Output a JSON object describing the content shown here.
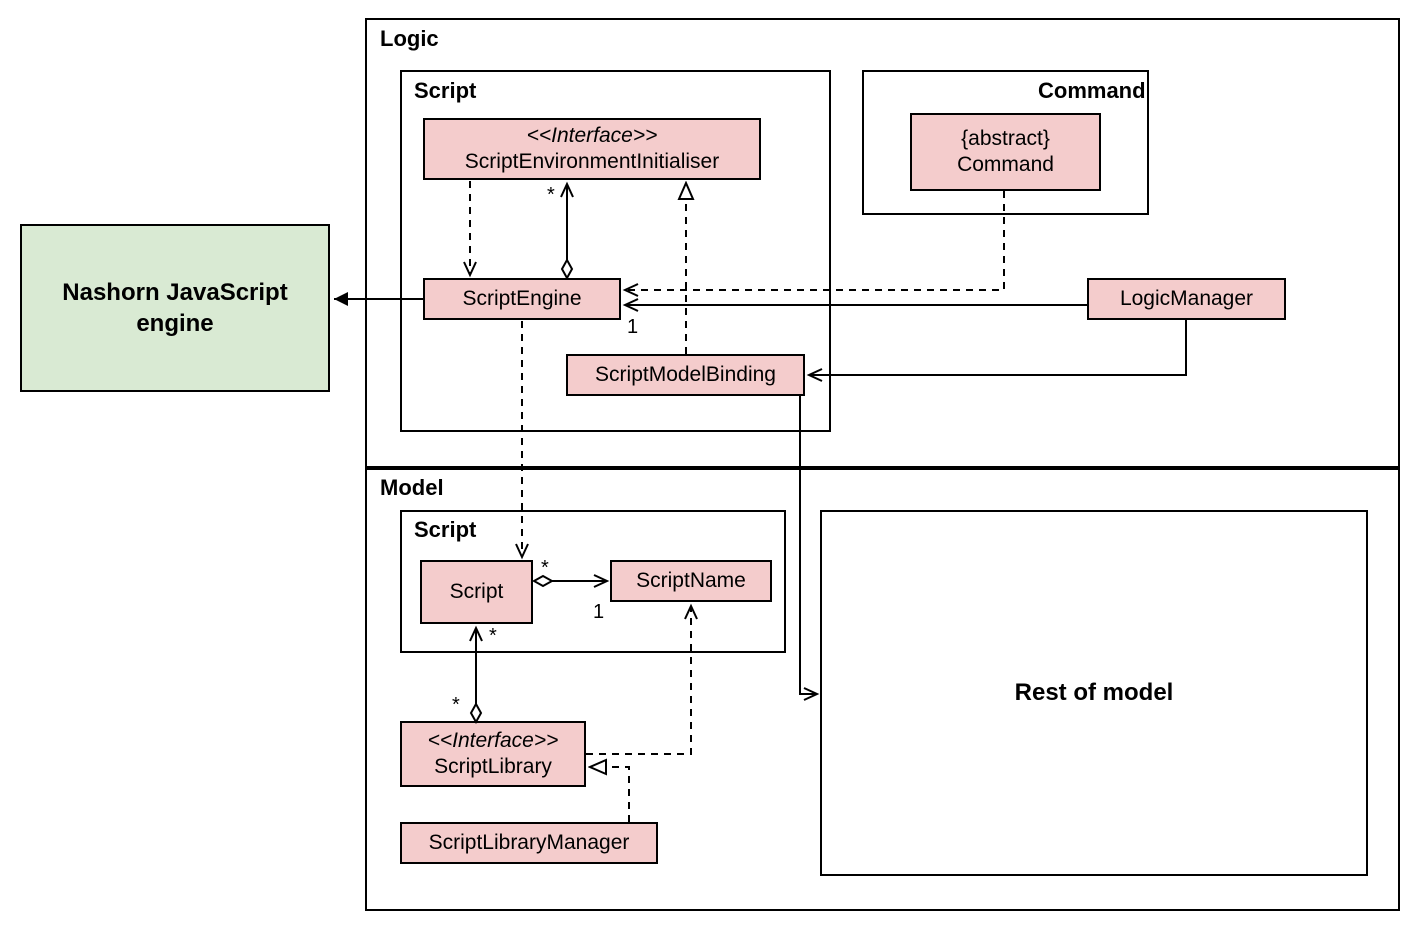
{
  "packages": {
    "logic": {
      "label": "Logic"
    },
    "logic_script": {
      "label": "Script"
    },
    "logic_command": {
      "label": "Command"
    },
    "model": {
      "label": "Model"
    },
    "model_script": {
      "label": "Script"
    }
  },
  "classes": {
    "nashorn": {
      "line1": "Nashorn JavaScript",
      "line2": "engine"
    },
    "script_env_init": {
      "stereotype": "<<Interface>>",
      "name": "ScriptEnvironmentInitialiser"
    },
    "script_engine": {
      "name": "ScriptEngine"
    },
    "script_model_binding": {
      "name": "ScriptModelBinding"
    },
    "command_abstract": {
      "stereotype": "{abstract}",
      "name": "Command"
    },
    "logic_manager": {
      "name": "LogicManager"
    },
    "script": {
      "name": "Script"
    },
    "script_name": {
      "name": "ScriptName"
    },
    "script_library": {
      "stereotype": "<<Interface>>",
      "name": "ScriptLibrary"
    },
    "script_library_manager": {
      "name": "ScriptLibraryManager"
    },
    "rest_of_model": {
      "name": "Rest of model"
    }
  },
  "multiplicities": {
    "m1": "*",
    "m2": "1",
    "m3": "*",
    "m4": "*",
    "m5": "1",
    "m6": "*"
  }
}
